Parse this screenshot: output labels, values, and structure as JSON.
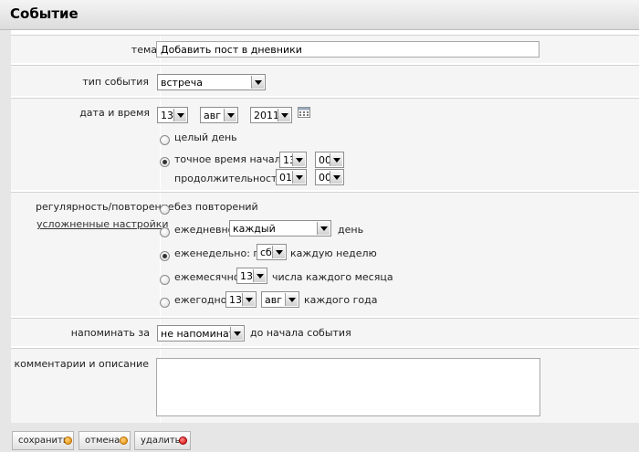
{
  "window": {
    "title": "Событие"
  },
  "topic": {
    "label": "тема",
    "value": "Добавить пост в дневники"
  },
  "event_type": {
    "label": "тип события",
    "value": "встреча"
  },
  "datetime": {
    "label": "дата и время",
    "day": "13",
    "month": "авг",
    "year": "2011",
    "all_day_label": "целый день",
    "exact_time_label": "точное время начала:",
    "start_hour": "13",
    "start_minute": "00",
    "duration_label": "продолжительность:",
    "duration_hour": "01",
    "duration_minute": "00"
  },
  "recurrence": {
    "label": "регулярность/повторение",
    "advanced_link": "усложненные настройки",
    "none_label": "без повторений",
    "daily_label": "ежедневно:",
    "daily_value": "каждый",
    "daily_suffix": "день",
    "weekly_label": "еженедельно: по",
    "weekly_value": "сб",
    "weekly_suffix": "каждую неделю",
    "monthly_label": "ежемесячно:",
    "monthly_value": "13",
    "monthly_suffix": "числа каждого месяца",
    "yearly_label": "ежегодно:",
    "yearly_day": "13",
    "yearly_month": "авг",
    "yearly_suffix": "каждого года"
  },
  "reminder": {
    "label": "напоминать за",
    "value": "не напоминать",
    "suffix": "до начала события"
  },
  "comments": {
    "label": "комментарии и описание",
    "value": ""
  },
  "buttons": {
    "save": "сохранить",
    "cancel": "отмена",
    "delete": "удалить"
  },
  "colors": {
    "orange_dot": "#e08a00",
    "red_dot": "#d10000",
    "section_bg": "#f5f5f5"
  }
}
